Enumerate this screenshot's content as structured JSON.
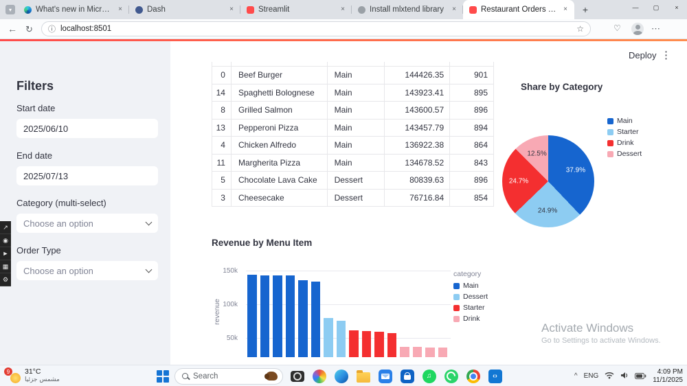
{
  "browser": {
    "tabs": [
      {
        "title": "What's new in Microsoft Edge",
        "favicon": "edge",
        "active": false
      },
      {
        "title": "Dash",
        "favicon": "dash",
        "active": false
      },
      {
        "title": "Streamlit",
        "favicon": "streamlit",
        "active": false
      },
      {
        "title": "Install mlxtend library",
        "favicon": "package",
        "active": false
      },
      {
        "title": "Restaurant Orders Dashboard",
        "favicon": "streamlit",
        "active": true
      }
    ],
    "close_glyph": "×",
    "new_tab_label": "+",
    "window_controls": [
      "—",
      "▢",
      "×"
    ],
    "nav": {
      "back": "←",
      "refresh": "↻"
    },
    "address": {
      "info_icon": "ⓘ",
      "url": "localhost:8501",
      "star": "☆"
    },
    "essentials_icon": "♡",
    "menu_ellipsis": "⋯"
  },
  "app": {
    "deploy_label": "Deploy",
    "kebab": "⋮",
    "sidebar": {
      "title": "Filters",
      "fields": [
        {
          "label": "Start date",
          "kind": "input",
          "value": "2025/06/10"
        },
        {
          "label": "End date",
          "kind": "input",
          "value": "2025/07/13"
        },
        {
          "label": "Category (multi-select)",
          "kind": "select",
          "placeholder": "Choose an option"
        },
        {
          "label": "Order Type",
          "kind": "select",
          "placeholder": "Choose an option"
        }
      ]
    },
    "table": {
      "rows": [
        [
          "0",
          "Beef Burger",
          "Main",
          "144426.35",
          "901"
        ],
        [
          "14",
          "Spaghetti Bolognese",
          "Main",
          "143923.41",
          "895"
        ],
        [
          "8",
          "Grilled Salmon",
          "Main",
          "143600.57",
          "896"
        ],
        [
          "13",
          "Pepperoni Pizza",
          "Main",
          "143457.79",
          "894"
        ],
        [
          "4",
          "Chicken Alfredo",
          "Main",
          "136922.38",
          "864"
        ],
        [
          "11",
          "Margherita Pizza",
          "Main",
          "134678.52",
          "843"
        ],
        [
          "5",
          "Chocolate Lava Cake",
          "Dessert",
          "80839.63",
          "896"
        ],
        [
          "3",
          "Cheesecake",
          "Dessert",
          "76716.84",
          "854"
        ]
      ]
    },
    "pie_title": "Share by Category",
    "bar_title": "Revenue by Menu Item",
    "watermark": {
      "line1": "Activate Windows",
      "line2": "Go to Settings to activate Windows."
    }
  },
  "chart_data": [
    {
      "type": "pie",
      "title": "Share by Category",
      "labels": [
        "Main",
        "Starter",
        "Drink",
        "Dessert"
      ],
      "values": [
        37.9,
        24.9,
        24.7,
        12.5
      ],
      "value_labels": [
        "37.9%",
        "24.9%",
        "24.7%",
        "12.5%"
      ],
      "colors": [
        "#1665cf",
        "#8dccf2",
        "#f42f30",
        "#f8a9b4"
      ],
      "legend_position": "right"
    },
    {
      "type": "bar",
      "title": "Revenue by Menu Item",
      "ylabel": "revenue",
      "yticks": [
        50000,
        100000,
        150000
      ],
      "ytick_labels": [
        "50k",
        "100k",
        "150k"
      ],
      "ylim": [
        0,
        155000
      ],
      "legend_title": "category",
      "legend": [
        "Main",
        "Dessert",
        "Starter",
        "Drink"
      ],
      "colors": {
        "Main": "#1665cf",
        "Dessert": "#8dccf2",
        "Starter": "#f42f30",
        "Drink": "#f8a9b4"
      },
      "bars": [
        {
          "category": "Main",
          "value": 144426
        },
        {
          "category": "Main",
          "value": 143923
        },
        {
          "category": "Main",
          "value": 143601
        },
        {
          "category": "Main",
          "value": 143458
        },
        {
          "category": "Main",
          "value": 136922
        },
        {
          "category": "Main",
          "value": 134679
        },
        {
          "category": "Dessert",
          "value": 80840
        },
        {
          "category": "Dessert",
          "value": 76717
        },
        {
          "category": "Starter",
          "value": 62000
        },
        {
          "category": "Starter",
          "value": 61000
        },
        {
          "category": "Starter",
          "value": 60000
        },
        {
          "category": "Starter",
          "value": 58500
        },
        {
          "category": "Drink",
          "value": 38000
        },
        {
          "category": "Drink",
          "value": 37500
        },
        {
          "category": "Drink",
          "value": 37000
        },
        {
          "category": "Drink",
          "value": 36500
        }
      ]
    }
  ],
  "capture_toolbar": {
    "icons": [
      "share",
      "camera",
      "record",
      "window",
      "settings"
    ]
  },
  "taskbar": {
    "weather": {
      "badge": "9",
      "temp": "31°C",
      "condition": "مشمس جزئيا"
    },
    "search": {
      "placeholder": "Search"
    },
    "apps": [
      "camera",
      "photos",
      "edge",
      "file-explorer",
      "mail",
      "store",
      "spotify",
      "whatsapp",
      "chrome",
      "vscode"
    ],
    "tray": {
      "chevron": "^",
      "language": "ENG",
      "time": "4:09 PM",
      "date": "11/1/2025"
    }
  }
}
